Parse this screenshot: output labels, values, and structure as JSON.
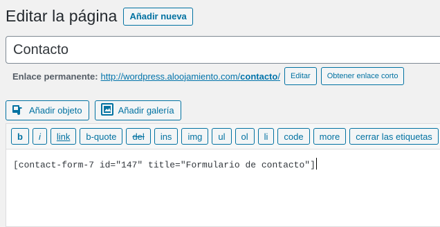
{
  "header": {
    "title": "Editar la página",
    "add_new_label": "Añadir nueva"
  },
  "post": {
    "title_value": "Contacto"
  },
  "permalink": {
    "label": "Enlace permanente:",
    "url_base": "http://wordpress.aloojamiento.com/",
    "slug": "contacto",
    "url_tail": "/",
    "edit_label": "Editar",
    "shortlink_label": "Obtener enlace corto"
  },
  "media": {
    "add_media_label": "Añadir objeto",
    "add_media_icon": "media-icon",
    "add_gallery_label": "Añadir galería",
    "add_gallery_icon": "gallery-icon"
  },
  "quicktags": [
    "b",
    "i",
    "link",
    "b-quote",
    "del",
    "ins",
    "img",
    "ul",
    "ol",
    "li",
    "code",
    "more",
    "cerrar las etiquetas"
  ],
  "editor": {
    "content": "[contact-form-7 id=\"147\" title=\"Formulario de contacto\"]"
  },
  "colors": {
    "accent": "#0071a1",
    "link": "#0073aa",
    "background": "#f1f1f1"
  }
}
